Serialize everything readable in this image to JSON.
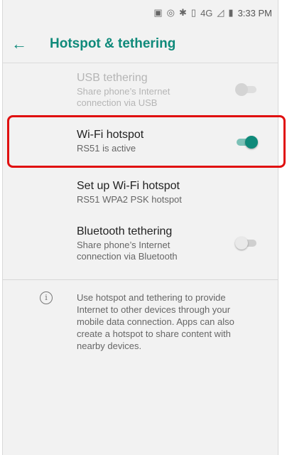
{
  "status_bar": {
    "time": "3:33 PM",
    "network": "4G"
  },
  "app_bar": {
    "title": "Hotspot & tethering"
  },
  "settings": [
    {
      "title": "USB tethering",
      "summary": "Share phone’s Internet\nconnection via USB",
      "enabled": false,
      "toggle": "off"
    },
    {
      "title": "Wi-Fi hotspot",
      "summary": "RS51 is active",
      "enabled": true,
      "toggle": "on"
    },
    {
      "title": "Set up Wi-Fi hotspot",
      "summary": "RS51 WPA2 PSK hotspot",
      "enabled": true,
      "toggle": "none"
    },
    {
      "title": "Bluetooth tethering",
      "summary": "Share phone’s Internet\nconnection via Bluetooth",
      "enabled": true,
      "toggle": "off"
    }
  ],
  "info_text": "Use hotspot and tethering to provide Internet to other devices through your mobile data connection. Apps can also create a hotspot to share content with nearby devices.",
  "colors": {
    "accent": "#0f8a7a",
    "highlight": "#e01010"
  }
}
